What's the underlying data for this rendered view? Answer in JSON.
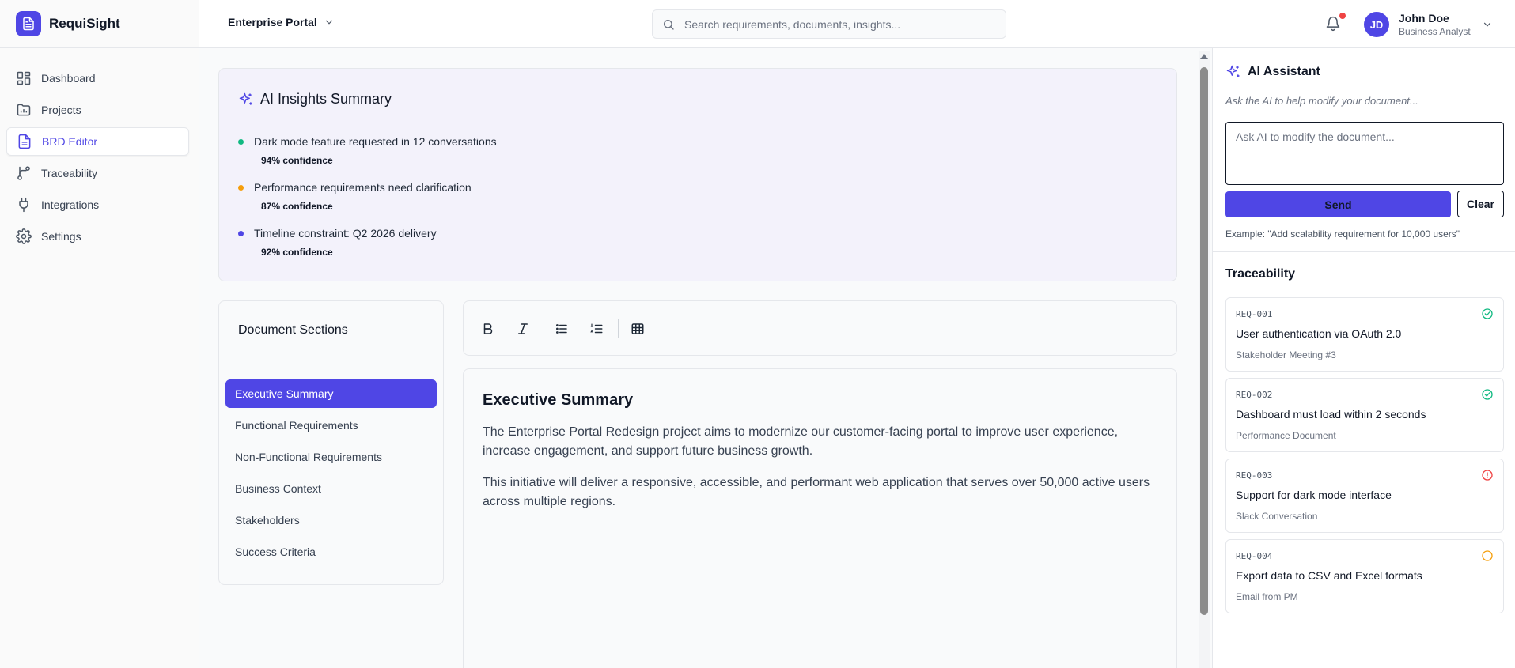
{
  "app": {
    "name": "RequiSight"
  },
  "sidebar": {
    "items": [
      {
        "label": "Dashboard",
        "icon": "dashboard-icon"
      },
      {
        "label": "Projects",
        "icon": "folder-icon"
      },
      {
        "label": "BRD Editor",
        "icon": "document-icon",
        "active": true
      },
      {
        "label": "Traceability",
        "icon": "git-branch-icon"
      },
      {
        "label": "Integrations",
        "icon": "plug-icon"
      },
      {
        "label": "Settings",
        "icon": "gear-icon"
      }
    ]
  },
  "header": {
    "portal": "Enterprise Portal",
    "search_placeholder": "Search requirements, documents, insights...",
    "user": {
      "initials": "JD",
      "name": "John Doe",
      "role": "Business Analyst"
    }
  },
  "insights": {
    "title": "AI Insights Summary",
    "items": [
      {
        "text": "Dark mode feature requested in 12 conversations",
        "confidence": "94% confidence",
        "color": "#10b981"
      },
      {
        "text": "Performance requirements need clarification",
        "confidence": "87% confidence",
        "color": "#f59e0b"
      },
      {
        "text": "Timeline constraint: Q2 2026 delivery",
        "confidence": "92% confidence",
        "color": "#4f46e5"
      }
    ]
  },
  "sections": {
    "title": "Document Sections",
    "items": [
      {
        "label": "Executive Summary",
        "active": true
      },
      {
        "label": "Functional Requirements"
      },
      {
        "label": "Non-Functional Requirements"
      },
      {
        "label": "Business Context"
      },
      {
        "label": "Stakeholders"
      },
      {
        "label": "Success Criteria"
      }
    ]
  },
  "toolbar": {
    "tools": [
      "bold-icon",
      "italic-icon",
      "bullet-list-icon",
      "numbered-list-icon",
      "table-icon"
    ]
  },
  "document": {
    "title": "Executive Summary",
    "paragraphs": [
      "The Enterprise Portal Redesign project aims to modernize our customer-facing portal to improve user experience, increase engagement, and support future business growth.",
      "This initiative will deliver a responsive, accessible, and performant web application that serves over 50,000 active users across multiple regions."
    ]
  },
  "assistant": {
    "title": "AI Assistant",
    "subtitle": "Ask the AI to help modify your document...",
    "input_placeholder": "Ask AI to modify the document...",
    "send_label": "Send",
    "clear_label": "Clear",
    "example": "Example: \"Add scalability requirement for 10,000 users\""
  },
  "traceability": {
    "title": "Traceability",
    "items": [
      {
        "id": "REQ-001",
        "text": "User authentication via OAuth 2.0",
        "source": "Stakeholder Meeting #3",
        "status": "verified",
        "status_color": "#10b981"
      },
      {
        "id": "REQ-002",
        "text": "Dashboard must load within 2 seconds",
        "source": "Performance Document",
        "status": "verified",
        "status_color": "#10b981"
      },
      {
        "id": "REQ-003",
        "text": "Support for dark mode interface",
        "source": "Slack Conversation",
        "status": "conflict",
        "status_color": "#ef4444"
      },
      {
        "id": "REQ-004",
        "text": "Export data to CSV and Excel formats",
        "source": "Email from PM",
        "status": "pending",
        "status_color": "#f59e0b"
      }
    ]
  }
}
